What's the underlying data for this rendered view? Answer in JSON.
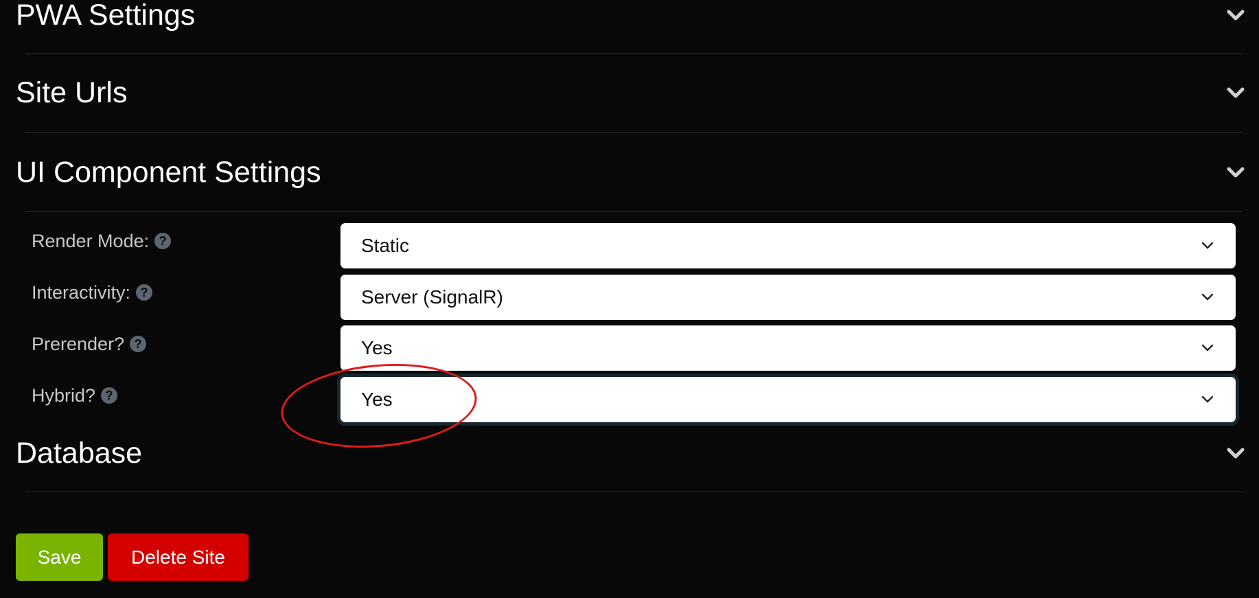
{
  "sections": {
    "pwa": {
      "title": "PWA Settings"
    },
    "site_urls": {
      "title": "Site Urls"
    },
    "ui_component": {
      "title": "UI Component Settings"
    },
    "database": {
      "title": "Database"
    }
  },
  "fields": {
    "render_mode": {
      "label": "Render Mode:",
      "value": "Static"
    },
    "interactivity": {
      "label": "Interactivity:",
      "value": "Server (SignalR)"
    },
    "prerender": {
      "label": "Prerender?",
      "value": "Yes"
    },
    "hybrid": {
      "label": "Hybrid?",
      "value": "Yes"
    }
  },
  "help_icon_glyph": "?",
  "buttons": {
    "save": "Save",
    "delete_site": "Delete Site"
  },
  "colors": {
    "background": "#080808",
    "save": "#7ab400",
    "delete": "#d40000",
    "annotation": "#e01a1a"
  }
}
